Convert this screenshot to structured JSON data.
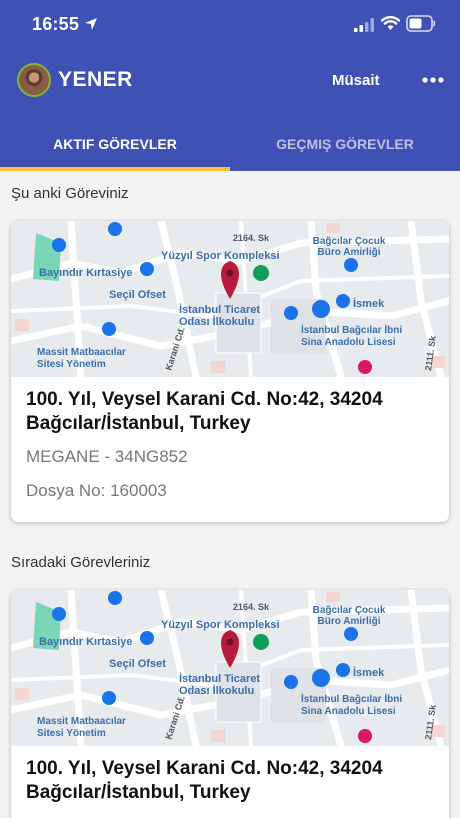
{
  "status_bar": {
    "time": "16:55"
  },
  "header": {
    "username": "YENER",
    "status": "Müsait"
  },
  "tabs": [
    {
      "label": "AKTIF GÖREVLER",
      "active": true
    },
    {
      "label": "GEÇMIŞ GÖREVLER",
      "active": false
    }
  ],
  "current_task": {
    "section_title": "Şu anki Göreviniz",
    "address": "100. Yıl, Veysel Karani Cd. No:42, 34204 Bağcılar/İstanbul, Turkey",
    "vehicle": "MEGANE - 34NG852",
    "file_no": "Dosya No: 160003"
  },
  "next_tasks": {
    "section_title": "Sıradaki Görevleriniz",
    "items": [
      {
        "address": "100. Yıl, Veysel Karani Cd. No:42, 34204 Bağcılar/İstanbul, Turkey"
      }
    ]
  },
  "map_labels": {
    "cocuk_1": "Bağcılar Çocuk",
    "cocuk_2": "Büro Amirliği",
    "street_2164": "2164. Sk",
    "kirtasiye": "Bayındır Kırtasiye",
    "spor": "Yüzyıl Spor Kompleksi",
    "ofset": "Seçil Ofset",
    "ismek": "İsmek",
    "ticaret_1": "İstanbul Ticaret",
    "ticaret_2": "Odası İlkokulu",
    "lise_1": "İstanbul Bağcılar İbni",
    "lise_2": "Sina Anadolu Lisesi",
    "matbaa_1": "Massit Matbaacılar",
    "matbaa_2": "Sitesi Yönetim",
    "karani": "Karani Cd.",
    "street_2111": "2111. Sk"
  },
  "colors": {
    "primary": "#3f51b5",
    "accent": "#ffc233",
    "pin": "#b71c3c",
    "map_icon_blue": "#1a73e8",
    "map_icon_green": "#0f9d58"
  },
  "icons": [
    "location-arrow-icon",
    "signal-icon",
    "wifi-icon",
    "battery-icon",
    "more-icon",
    "map-pin-icon"
  ]
}
